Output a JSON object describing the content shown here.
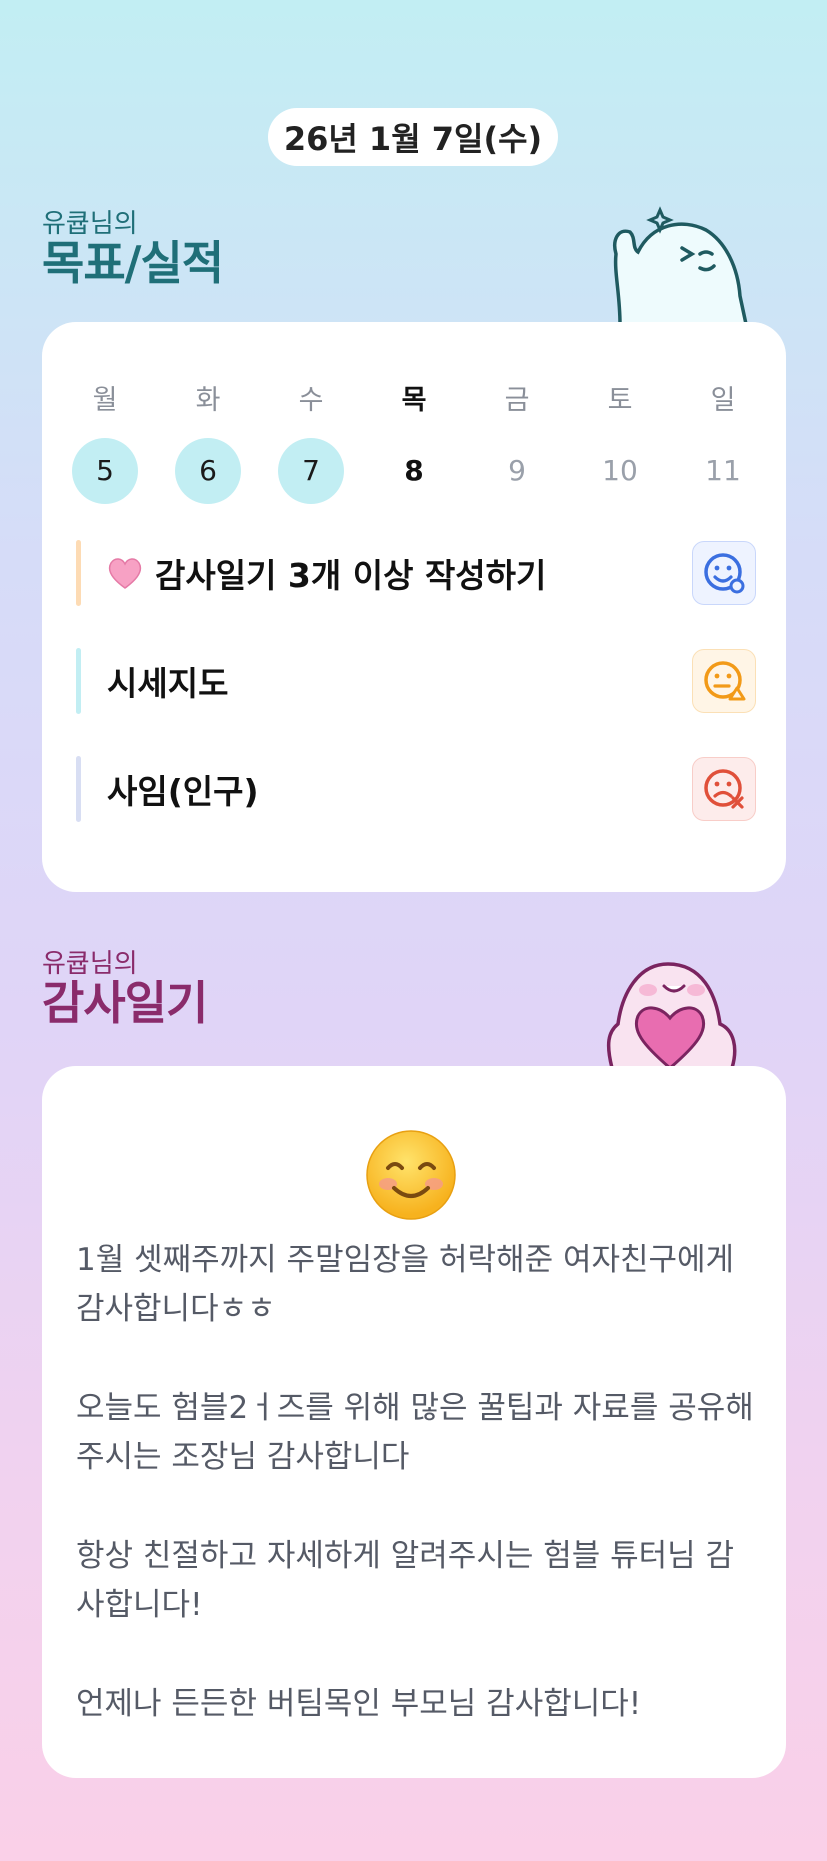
{
  "date": "26년 1월 7일(수)",
  "goals_section": {
    "subtitle": "유큡님의",
    "title": "목표/실적"
  },
  "week": [
    {
      "name": "월",
      "num": "5",
      "state": "done"
    },
    {
      "name": "화",
      "num": "6",
      "state": "done"
    },
    {
      "name": "수",
      "num": "7",
      "state": "done"
    },
    {
      "name": "목",
      "num": "8",
      "state": "today"
    },
    {
      "name": "금",
      "num": "9",
      "state": "future"
    },
    {
      "name": "토",
      "num": "10",
      "state": "future"
    },
    {
      "name": "일",
      "num": "11",
      "state": "future"
    }
  ],
  "goals": [
    {
      "icon": "pink-heart-emoji",
      "label": "감사일기 3개 이상 작성하기",
      "bar_color": "#fddbb4",
      "status": "happy-face-icon",
      "status_color": "#3b6fe0"
    },
    {
      "label": "시세지도",
      "bar_color": "#c2eef3",
      "status": "neutral-face-icon",
      "status_color": "#f29a18"
    },
    {
      "label": "사임(인구)",
      "bar_color": "#d8def3",
      "status": "sad-face-icon",
      "status_color": "#e0503a"
    }
  ],
  "gratitude_section": {
    "subtitle": "유큡님의",
    "title": "감사일기"
  },
  "gratitude": {
    "emoji": "smiling-face-emoji",
    "entries": [
      "1월 셋째주까지 주말임장을 허락해준 여자친구에게 감사합니다ㅎㅎ",
      "오늘도 험블2ㅓ즈를 위해 많은 꿀팁과 자료를 공유해주시는 조장님 감사합니다",
      "항상 친절하고 자세하게 알려주시는 험블 튜터님 감사합니다!",
      "언제나 든든한 버팀목인 부모님 감사합니다!"
    ]
  },
  "colors": {
    "teal_title": "#1f6f78",
    "plum_title": "#8a2b6b",
    "done_day": "#c2eef3"
  }
}
